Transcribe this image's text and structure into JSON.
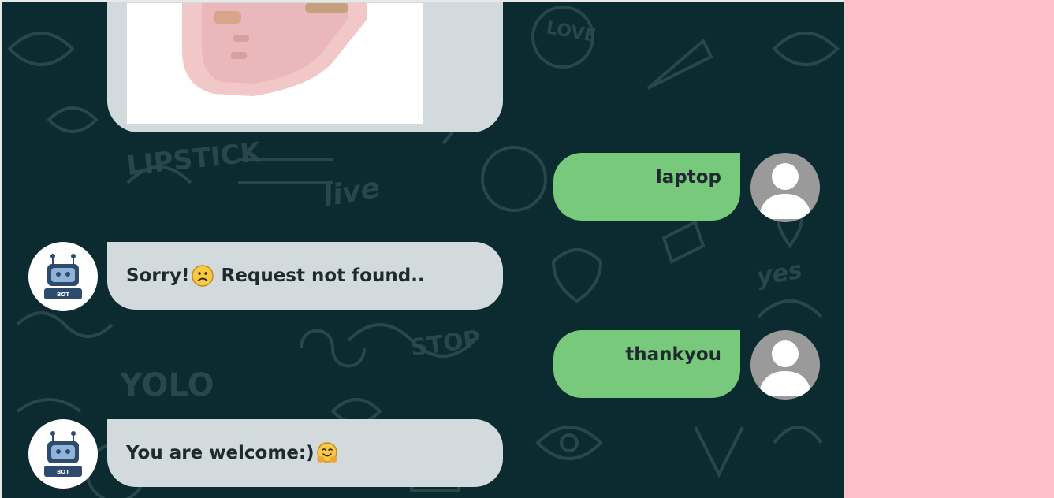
{
  "colors": {
    "chat_background": "#0b2b31",
    "bot_bubble": "#d3dadd",
    "user_bubble": "#78c97c",
    "side_panel": "#ffbfcb"
  },
  "messages": [
    {
      "sender": "bot",
      "type": "image",
      "icon": "smartwatch-product-image"
    },
    {
      "sender": "user",
      "text": "laptop"
    },
    {
      "sender": "bot",
      "text_before": "Sorry!",
      "emoji": "frowning-face",
      "text_after": " Request not found.."
    },
    {
      "sender": "user",
      "text": "thankyou"
    },
    {
      "sender": "bot",
      "text_before": "You are welcome:)",
      "emoji": "hugging-face",
      "text_after": ""
    }
  ],
  "bot_avatar": {
    "icon": "robot-icon",
    "label": "BOT"
  }
}
